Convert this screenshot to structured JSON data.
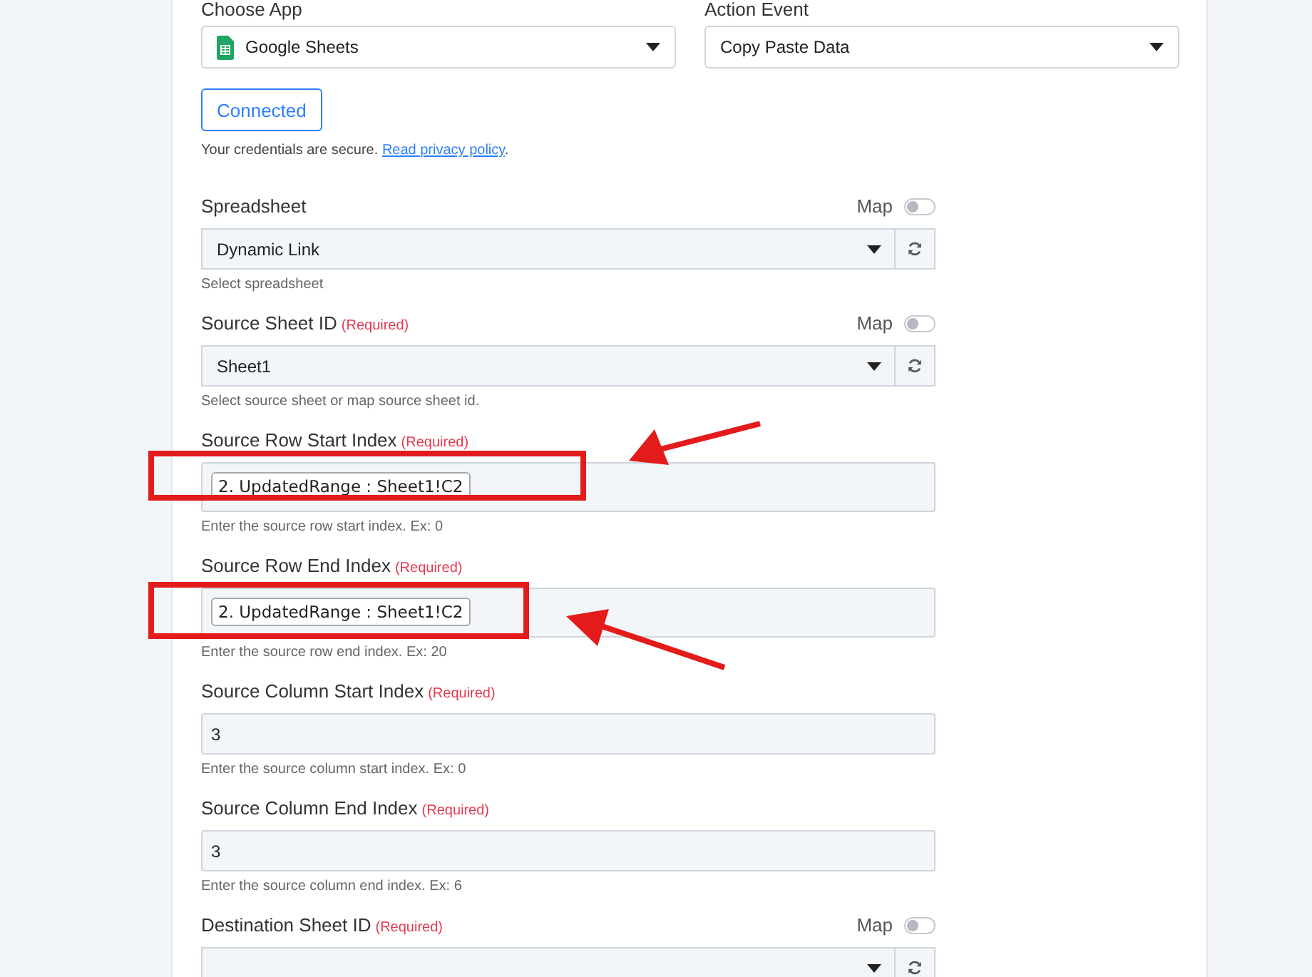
{
  "app_select": {
    "label": "Choose App",
    "value": "Google Sheets"
  },
  "event_select": {
    "label": "Action Event",
    "value": "Copy Paste Data"
  },
  "connect_button": {
    "label": "Connected"
  },
  "credentials_note": {
    "text": "Your credentials are secure.",
    "link": "Read privacy policy",
    "end": "."
  },
  "fields": [
    {
      "kind": "select",
      "label": "Spreadsheet",
      "map_label": "Map",
      "map_on": false,
      "value": "Dynamic Link",
      "help": "Select spreadsheet",
      "highlighted": false
    },
    {
      "kind": "select",
      "label": "Source Sheet ID",
      "required": "(Required)",
      "map_label": "Map",
      "map_on": false,
      "value": "Sheet1",
      "help": "Select source sheet or map source sheet id.",
      "highlighted": false
    },
    {
      "kind": "tag",
      "label": "Source Row Start Index",
      "required": "(Required)",
      "value": "2. UpdatedRange : Sheet1!C2",
      "help": "Enter the source row start index. Ex: 0",
      "highlighted": true
    },
    {
      "kind": "tag",
      "label": "Source Row End Index",
      "required": "(Required)",
      "value": "2. UpdatedRange : Sheet1!C2",
      "help": "Enter the source row end index. Ex: 20",
      "highlighted": true
    },
    {
      "kind": "text",
      "label": "Source Column Start Index",
      "required": "(Required)",
      "value": "3",
      "help": "Enter the source column start index. Ex: 0",
      "highlighted": false
    },
    {
      "kind": "text",
      "label": "Source Column End Index",
      "required": "(Required)",
      "value": "3",
      "help": "Enter the source column end index. Ex: 6",
      "highlighted": false
    },
    {
      "kind": "select",
      "label": "Destination Sheet ID",
      "required": "(Required)",
      "map_label": "Map",
      "map_on": false,
      "highlighted": false
    }
  ]
}
